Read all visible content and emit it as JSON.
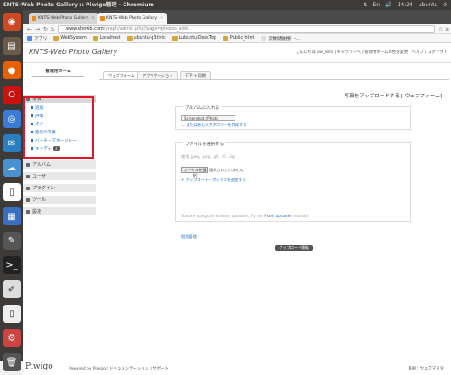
{
  "topbar": {
    "title": "KNTS-Web Photo Gallery :: Piwigo管理 - Chromium",
    "time": "14:24",
    "user": "ubuntu"
  },
  "tabs": [
    {
      "label": "KNTS-Web Photo Gallery"
    },
    {
      "label": "KNTS-Web Photo Gallery"
    }
  ],
  "url": {
    "host": "www.showb.com",
    "path": "/graph/admin.php?page=photos_add"
  },
  "bookmarks": [
    "アプリ",
    "WebSystem",
    "Localhost",
    "ubuntu-g3tivic",
    "Lubuntu-DeskTop",
    "Public_html",
    "云数储融搜！-…"
  ],
  "header": {
    "title": "KNTS-Web Photo Gallery",
    "links": "こんにちは pw_knts | ギャラリーへ | 管理用ホームの色を変更 | ヘルプ | ログアウト"
  },
  "sidebar": {
    "home": "管理用ホーム",
    "photos": "写真",
    "sub": [
      {
        "label": "追加"
      },
      {
        "label": "評価"
      },
      {
        "label": "タグ"
      },
      {
        "label": "最近の写真"
      },
      {
        "label": "バッチ・マネージャー"
      },
      {
        "label": "キャディ",
        "badge": "2"
      }
    ],
    "sections": [
      "アルバム",
      "ユーザ",
      "プラグイン",
      "ツール",
      "設定"
    ]
  },
  "content": {
    "tabs": [
      "ウェブフォーム",
      "アプリケーション",
      "FTP + 同期"
    ],
    "title": "写真をアップロードする [ ウェブフォーム]",
    "album": {
      "legend": "アルバムに入れる",
      "select": "Screenshot / Photo",
      "create_link": "... または新しいカテゴリーを作成する"
    },
    "files": {
      "legend": "ファイルを選択する",
      "types": "使用 .jpeg, .png, .gif, .tif, .zip",
      "choose": "ファイルを選択",
      "none": "選択されていません",
      "add_box": "+ アップロード・ボックスを追加する",
      "note_prefix": "You are using the Browser uploader. Try the",
      "note_link": "Flash uploader",
      "note_suffix": "instead."
    },
    "settings_link": "個別管理",
    "start_button": "アップロード開始"
  },
  "footer": {
    "logo": "Piwigo",
    "powered": "Powered by Piwigo | ドキュメンテーション | サポート",
    "right": "技術：ウェブマスタ"
  }
}
